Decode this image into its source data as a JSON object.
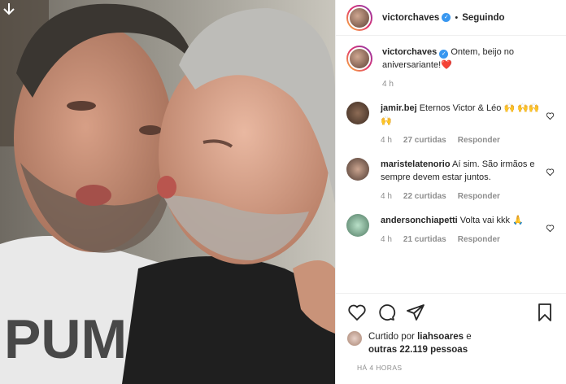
{
  "post": {
    "author": "victorchaves",
    "follow_status": "Seguindo",
    "dot": "•"
  },
  "caption": {
    "user": "victorchaves",
    "text": " Ontem, beijo no aniversariante!",
    "emoji": "❤️",
    "age": "4 h"
  },
  "comments": [
    {
      "user": "jamir.bej",
      "text": " Eternos Victor & Léo 🙌 🙌🙌🙌",
      "age": "4 h",
      "likes": "27 curtidas",
      "reply": "Responder"
    },
    {
      "user": "maristelatenorio",
      "text": " Aí sim. São irmãos e sempre devem estar juntos.",
      "age": "4 h",
      "likes": "22 curtidas",
      "reply": "Responder"
    },
    {
      "user": "andersonchiapetti",
      "text": " Volta vai kkk 🙏",
      "age": "4 h",
      "likes": "21 curtidas",
      "reply": "Responder"
    }
  ],
  "likes": {
    "prefix": "Curtido por ",
    "user": "liahsoares",
    "mid": " e",
    "others": "outras 22.119 pessoas"
  },
  "timestamp": "HÁ 4 HORAS",
  "icons": {
    "download": "download-arrow-icon",
    "verified": "verified-badge-icon",
    "heart": "heart-icon",
    "comment": "comment-icon",
    "share": "share-icon",
    "save": "bookmark-icon"
  },
  "colors": {
    "verified": "#3897f0",
    "heart": "#ed4956",
    "muted": "#8e8e8e"
  }
}
